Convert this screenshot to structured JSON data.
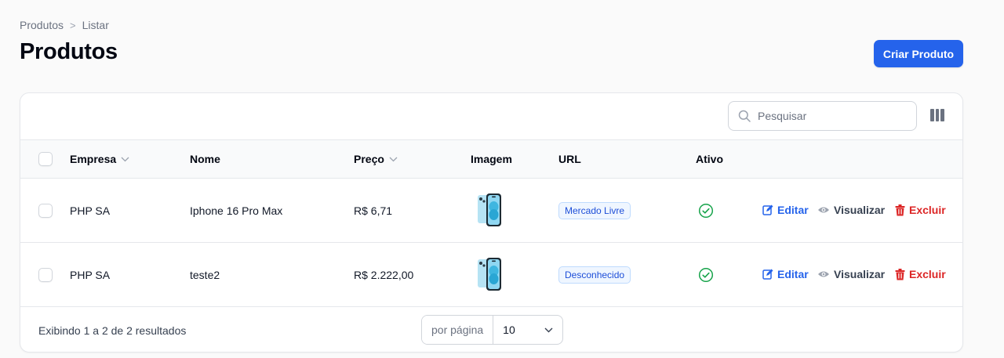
{
  "breadcrumb": {
    "items": [
      "Produtos",
      "Listar"
    ],
    "separator": ">"
  },
  "page": {
    "title": "Produtos",
    "create_label": "Criar Produto"
  },
  "search": {
    "placeholder": "Pesquisar"
  },
  "table": {
    "headers": {
      "empresa": "Empresa",
      "nome": "Nome",
      "preco": "Preço",
      "imagem": "Imagem",
      "url": "URL",
      "ativo": "Ativo"
    },
    "rows": [
      {
        "empresa": "PHP SA",
        "nome": "Iphone 16 Pro Max",
        "preco": "R$ 6,71",
        "url": "Mercado Livre",
        "ativo": true
      },
      {
        "empresa": "PHP SA",
        "nome": "teste2",
        "preco": "R$ 2.222,00",
        "url": "Desconhecido",
        "ativo": true
      }
    ],
    "actions": {
      "edit": "Editar",
      "view": "Visualizar",
      "delete": "Excluir"
    }
  },
  "footer": {
    "summary": "Exibindo 1 a 2 de 2 resultados",
    "per_page_label": "por página",
    "per_page_value": "10"
  },
  "colors": {
    "primary": "#2563eb",
    "danger": "#dc2626",
    "success": "#16a34a"
  },
  "icons": [
    "search-icon",
    "columns-icon",
    "chevron-down-icon",
    "check-circle-icon",
    "edit-icon",
    "eye-icon",
    "trash-icon",
    "phone-image"
  ]
}
